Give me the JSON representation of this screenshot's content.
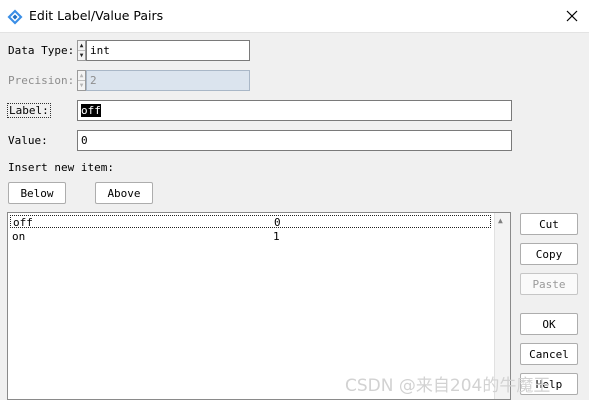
{
  "window": {
    "title": "Edit Label/Value Pairs",
    "app_icon": "diamond-app-icon",
    "close_icon": "close-icon"
  },
  "form": {
    "data_type": {
      "label": "Data Type:",
      "value": "int"
    },
    "precision": {
      "label": "Precision:",
      "value": "2",
      "enabled": false
    },
    "label_field": {
      "label": "Label:",
      "value": "off"
    },
    "value_field": {
      "label": "Value:",
      "value": "0"
    }
  },
  "insert": {
    "heading": "Insert new item:",
    "below_label": "Below",
    "above_label": "Above"
  },
  "list": {
    "rows": [
      {
        "label": "off",
        "value": "0",
        "selected": true
      },
      {
        "label": "on",
        "value": "1",
        "selected": false
      }
    ]
  },
  "buttons": {
    "cut": "Cut",
    "copy": "Copy",
    "paste": "Paste",
    "ok": "OK",
    "cancel": "Cancel",
    "help": "Help"
  },
  "watermark": "CSDN @来自204的牛魔王",
  "colors": {
    "dialog_bg": "#f0f0f0",
    "disabled_field_bg": "#dbe4ee",
    "icon_blue": "#3a8ee6"
  }
}
